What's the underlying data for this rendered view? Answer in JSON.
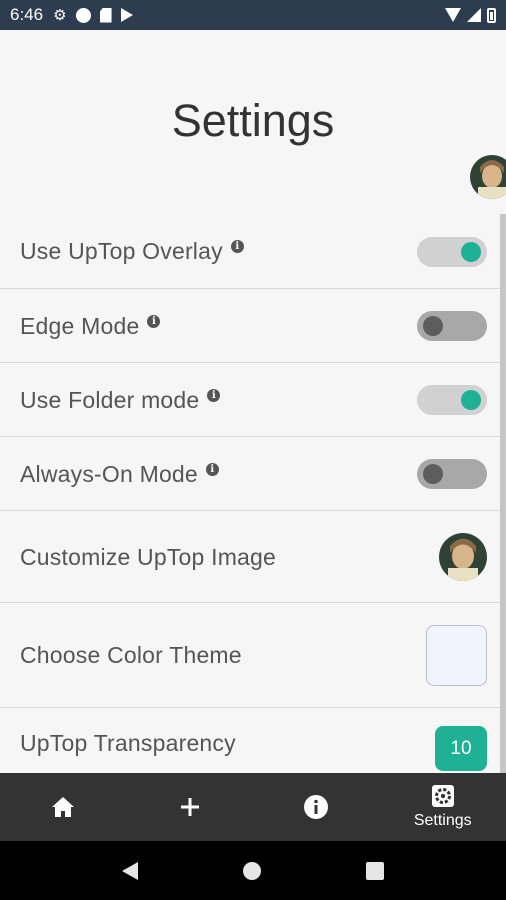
{
  "status_bar": {
    "time": "6:46",
    "icons_left": [
      "gear-icon",
      "circle-icon",
      "sd-card-icon",
      "play-store-icon"
    ],
    "icons_right": [
      "wifi-icon",
      "signal-icon",
      "battery-icon"
    ]
  },
  "page": {
    "title": "Settings"
  },
  "settings": {
    "overlay": {
      "label": "Use UpTop Overlay",
      "on": true
    },
    "edge": {
      "label": "Edge Mode",
      "on": false
    },
    "folder": {
      "label": "Use Folder mode",
      "on": true
    },
    "always_on": {
      "label": "Always-On Mode",
      "on": false
    },
    "customize_image": {
      "label": "Customize UpTop Image"
    },
    "color_theme": {
      "label": "Choose Color Theme",
      "swatch_color": "#f1f4fd"
    },
    "transparency": {
      "label": "UpTop Transparency",
      "value": "10"
    }
  },
  "info_glyph": "i",
  "bottom_nav": {
    "items": [
      {
        "icon": "home-icon",
        "label": ""
      },
      {
        "icon": "plus-icon",
        "label": ""
      },
      {
        "icon": "info-icon",
        "label": ""
      },
      {
        "icon": "settings-gear-icon",
        "label": "Settings"
      }
    ]
  },
  "colors": {
    "accent": "#1eb195",
    "status_bar": "#2d3d4f",
    "bottom_nav": "#333333"
  }
}
